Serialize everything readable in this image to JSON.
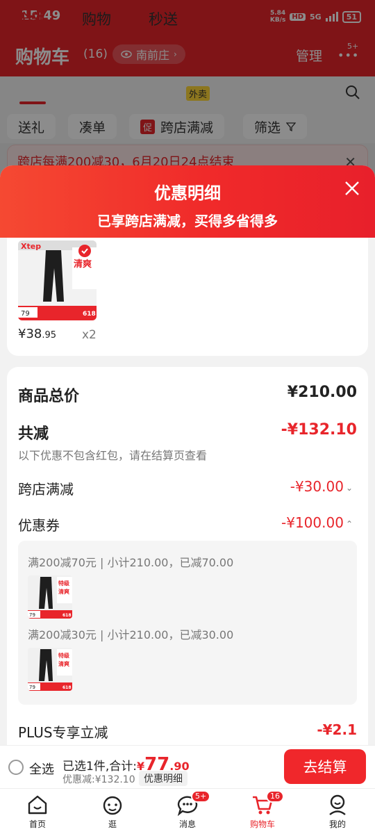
{
  "status_bar": {
    "time": "15:49",
    "speed_value": "5.84",
    "speed_unit": "KB/s",
    "hd": "HD",
    "network": "5G",
    "battery": "51"
  },
  "header": {
    "title": "购物车",
    "count": "(16)",
    "location": "南前庄",
    "manage": "管理",
    "more_badge": "5+"
  },
  "tabs": [
    {
      "label": "全部",
      "active": true
    },
    {
      "label": "购物"
    },
    {
      "label": "秒送"
    }
  ],
  "waimai_tag": "外卖",
  "filters": [
    {
      "label": "送礼"
    },
    {
      "label": "凑单"
    },
    {
      "tag": "促",
      "label": "跨店满减"
    },
    {
      "label": "筛选"
    }
  ],
  "banner": {
    "text": "跨店每满200减30，6月20日24点结束"
  },
  "sheet": {
    "title": "优惠明细",
    "subtitle": "已享跨店满减，买得多省得多"
  },
  "product": {
    "price_yen": "¥",
    "price_int": "38",
    "price_dec": ".95",
    "qty": "x2",
    "brand": "Xtep",
    "img_text": "清爽",
    "img_price": "618",
    "img_small": "79"
  },
  "summary": {
    "total_label": "商品总价",
    "total_value": "¥210.00",
    "reduce_label": "共减",
    "reduce_value": "-¥132.10",
    "note": "以下优惠不包含红包，请在结算页查看",
    "cross_store_label": "跨店满减",
    "cross_store_value": "-¥30.00",
    "coupon_label": "优惠券",
    "coupon_value": "-¥100.00",
    "coupons": [
      {
        "text": "满200减70元 | 小计210.00，已减70.00"
      },
      {
        "text": "满200减30元 | 小计210.00，已减30.00"
      }
    ],
    "plus_label": "PLUS专享立减",
    "plus_value": "-¥2.1"
  },
  "mini_img": {
    "text1": "特级",
    "text2": "清爽",
    "price": "618",
    "small": "79"
  },
  "checkout": {
    "select_all": "全选",
    "selected_prefix": "已选1件,合计:",
    "yen": "¥",
    "total_int": "77",
    "total_dec": ".90",
    "discount_text": "优惠减:¥132.10",
    "detail_btn": "优惠明细",
    "pay_btn": "去结算"
  },
  "tabbar": [
    {
      "label": "首页",
      "icon": "home-icon"
    },
    {
      "label": "逛",
      "icon": "browse-icon"
    },
    {
      "label": "消息",
      "icon": "message-icon",
      "badge": "5+"
    },
    {
      "label": "购物车",
      "icon": "cart-icon",
      "badge": "16",
      "active": true
    },
    {
      "label": "我的",
      "icon": "profile-icon"
    }
  ],
  "colors": {
    "accent": "#e8252b",
    "sheet_header": "#f0272b"
  }
}
